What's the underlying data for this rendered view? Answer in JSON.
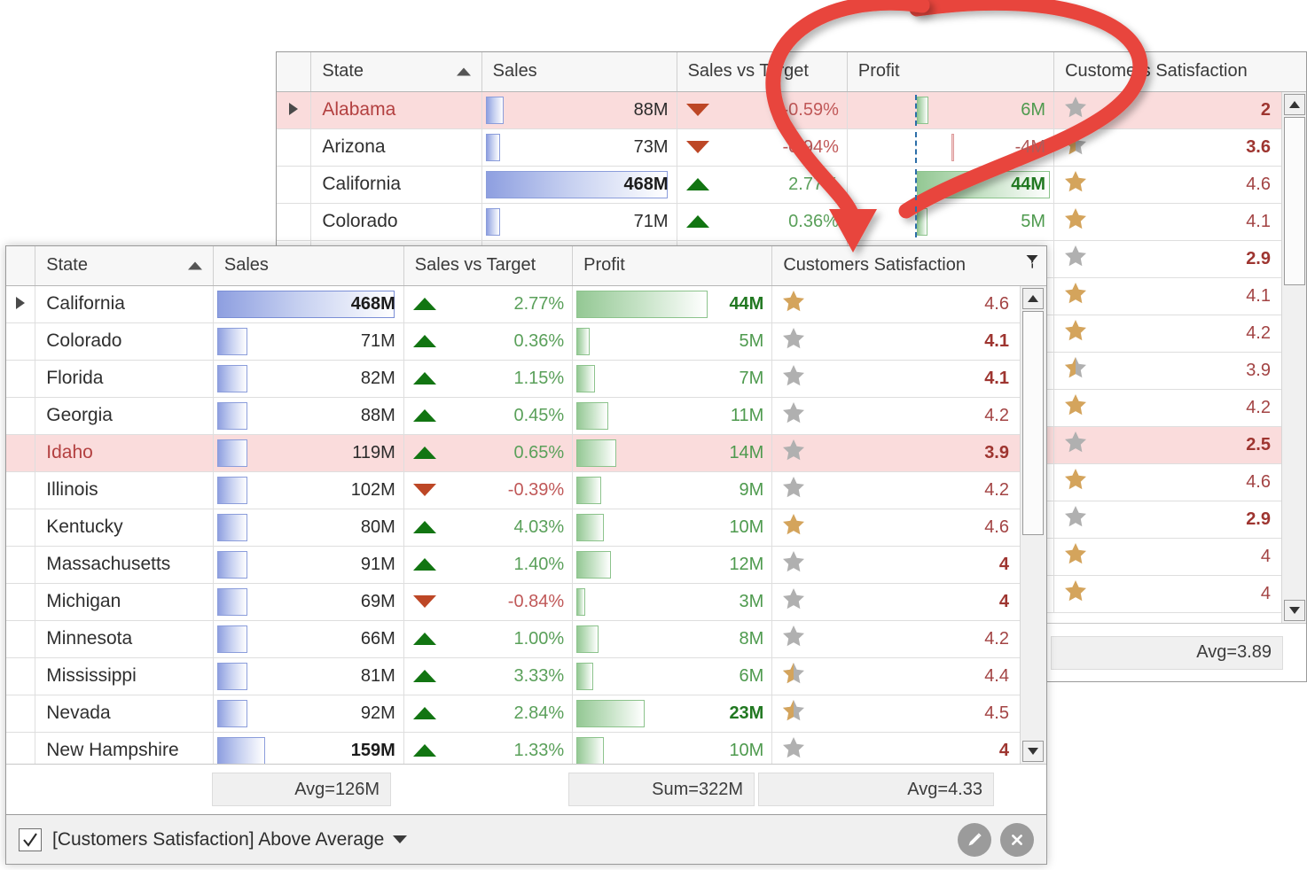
{
  "background_grid": {
    "name": "unfiltered-grid",
    "columns": [
      {
        "key": "state",
        "label": "State",
        "sorted": "asc"
      },
      {
        "key": "sales",
        "label": "Sales"
      },
      {
        "key": "svt",
        "label": "Sales vs Target"
      },
      {
        "key": "profit",
        "label": "Profit"
      },
      {
        "key": "sat",
        "label": "Customers Satisfaction"
      }
    ],
    "rows": [
      {
        "state": "Alabama",
        "sales": "88M",
        "sales_bar": 0.1,
        "svt": "-0.59%",
        "svt_dir": "down",
        "profit": "6M",
        "profit_bar": 0.09,
        "profit_neg": false,
        "sat": "2",
        "sat_bold": true,
        "star": "grey",
        "alert": true,
        "indicator": true,
        "sales_bold": false,
        "profit_bold": false
      },
      {
        "state": "Arizona",
        "sales": "73M",
        "sales_bar": 0.08,
        "svt": "-0.94%",
        "svt_dir": "down",
        "profit": "-4M",
        "profit_bar": 0.06,
        "profit_neg": true,
        "sat": "3.6",
        "sat_bold": true,
        "star": "gold-half",
        "alert": false,
        "indicator": false,
        "sales_bold": false,
        "profit_bold": false
      },
      {
        "state": "California",
        "sales": "468M",
        "sales_bar": 1.0,
        "svt": "2.77%",
        "svt_dir": "up",
        "profit": "44M",
        "profit_bar": 1.0,
        "profit_neg": false,
        "sat": "4.6",
        "sat_bold": false,
        "star": "gold",
        "alert": false,
        "indicator": false,
        "sales_bold": true,
        "profit_bold": true
      },
      {
        "state": "Colorado",
        "sales": "71M",
        "sales_bar": 0.08,
        "svt": "0.36%",
        "svt_dir": "up",
        "profit": "5M",
        "profit_bar": 0.08,
        "profit_neg": false,
        "sat": "4.1",
        "sat_bold": false,
        "star": "gold",
        "alert": false,
        "indicator": false,
        "sales_bold": false,
        "profit_bold": false
      }
    ],
    "satisfaction_tail": [
      {
        "sat": "2.9",
        "bold": true,
        "star": "grey",
        "alert": false
      },
      {
        "sat": "4.1",
        "bold": false,
        "star": "gold",
        "alert": false
      },
      {
        "sat": "4.2",
        "bold": false,
        "star": "gold",
        "alert": false
      },
      {
        "sat": "3.9",
        "bold": false,
        "star": "gold-half",
        "alert": false
      },
      {
        "sat": "4.2",
        "bold": false,
        "star": "gold",
        "alert": false
      },
      {
        "sat": "2.5",
        "bold": true,
        "star": "grey",
        "alert": true
      },
      {
        "sat": "4.6",
        "bold": false,
        "star": "gold",
        "alert": false
      },
      {
        "sat": "2.9",
        "bold": true,
        "star": "grey",
        "alert": false
      },
      {
        "sat": "4",
        "bold": false,
        "star": "gold",
        "alert": false
      },
      {
        "sat": "4",
        "bold": false,
        "star": "gold",
        "alert": false
      }
    ],
    "summary": {
      "satisfaction": "Avg=3.89"
    }
  },
  "foreground_grid": {
    "name": "filtered-grid",
    "columns": [
      {
        "key": "state",
        "label": "State",
        "sorted": "asc"
      },
      {
        "key": "sales",
        "label": "Sales"
      },
      {
        "key": "svt",
        "label": "Sales vs Target"
      },
      {
        "key": "profit",
        "label": "Profit"
      },
      {
        "key": "sat",
        "label": "Customers Satisfaction",
        "filtered": true
      }
    ],
    "rows": [
      {
        "state": "California",
        "sales": "468M",
        "sales_bar": 1.0,
        "sales_bold": true,
        "svt": "2.77%",
        "svt_dir": "up",
        "profit": "44M",
        "profit_bar": 1.0,
        "profit_bold": true,
        "sat": "4.6",
        "sat_bold": false,
        "star": "gold",
        "alert": false,
        "indicator": true
      },
      {
        "state": "Colorado",
        "sales": "71M",
        "sales_bar": 0.085,
        "sales_bold": false,
        "svt": "0.36%",
        "svt_dir": "up",
        "profit": "5M",
        "profit_bar": 0.1,
        "profit_bold": false,
        "sat": "4.1",
        "sat_bold": true,
        "star": "grey",
        "alert": false,
        "indicator": false
      },
      {
        "state": "Florida",
        "sales": "82M",
        "sales_bar": 0.1,
        "sales_bold": false,
        "svt": "1.15%",
        "svt_dir": "up",
        "profit": "7M",
        "profit_bar": 0.14,
        "profit_bold": false,
        "sat": "4.1",
        "sat_bold": true,
        "star": "grey",
        "alert": false,
        "indicator": false
      },
      {
        "state": "Georgia",
        "sales": "88M",
        "sales_bar": 0.11,
        "sales_bold": false,
        "svt": "0.45%",
        "svt_dir": "up",
        "profit": "11M",
        "profit_bar": 0.24,
        "profit_bold": false,
        "sat": "4.2",
        "sat_bold": false,
        "star": "grey",
        "alert": false,
        "indicator": false
      },
      {
        "state": "Idaho",
        "sales": "119M",
        "sales_bar": 0.165,
        "sales_bold": false,
        "svt": "0.65%",
        "svt_dir": "up",
        "profit": "14M",
        "profit_bar": 0.3,
        "profit_bold": false,
        "sat": "3.9",
        "sat_bold": true,
        "star": "grey",
        "alert": true,
        "indicator": false
      },
      {
        "state": "Illinois",
        "sales": "102M",
        "sales_bar": 0.135,
        "sales_bold": false,
        "svt": "-0.39%",
        "svt_dir": "down",
        "profit": "9M",
        "profit_bar": 0.19,
        "profit_bold": false,
        "sat": "4.2",
        "sat_bold": false,
        "star": "grey",
        "alert": false,
        "indicator": false
      },
      {
        "state": "Kentucky",
        "sales": "80M",
        "sales_bar": 0.1,
        "sales_bold": false,
        "svt": "4.03%",
        "svt_dir": "up",
        "profit": "10M",
        "profit_bar": 0.21,
        "profit_bold": false,
        "sat": "4.6",
        "sat_bold": false,
        "star": "gold",
        "alert": false,
        "indicator": false
      },
      {
        "state": "Massachusetts",
        "sales": "91M",
        "sales_bar": 0.115,
        "sales_bold": false,
        "svt": "1.40%",
        "svt_dir": "up",
        "profit": "12M",
        "profit_bar": 0.26,
        "profit_bold": false,
        "sat": "4",
        "sat_bold": true,
        "star": "grey",
        "alert": false,
        "indicator": false
      },
      {
        "state": "Michigan",
        "sales": "69M",
        "sales_bar": 0.08,
        "sales_bold": false,
        "svt": "-0.84%",
        "svt_dir": "down",
        "profit": "3M",
        "profit_bar": 0.05,
        "profit_bold": false,
        "sat": "4",
        "sat_bold": true,
        "star": "grey",
        "alert": false,
        "indicator": false
      },
      {
        "state": "Minnesota",
        "sales": "66M",
        "sales_bar": 0.075,
        "sales_bold": false,
        "svt": "1.00%",
        "svt_dir": "up",
        "profit": "8M",
        "profit_bar": 0.17,
        "profit_bold": false,
        "sat": "4.2",
        "sat_bold": false,
        "star": "grey",
        "alert": false,
        "indicator": false
      },
      {
        "state": "Mississippi",
        "sales": "81M",
        "sales_bar": 0.1,
        "sales_bold": false,
        "svt": "3.33%",
        "svt_dir": "up",
        "profit": "6M",
        "profit_bar": 0.13,
        "profit_bold": false,
        "sat": "4.4",
        "sat_bold": false,
        "star": "gold-half",
        "alert": false,
        "indicator": false
      },
      {
        "state": "Nevada",
        "sales": "92M",
        "sales_bar": 0.115,
        "sales_bold": false,
        "svt": "2.84%",
        "svt_dir": "up",
        "profit": "23M",
        "profit_bar": 0.52,
        "profit_bold": true,
        "sat": "4.5",
        "sat_bold": false,
        "star": "gold-half",
        "alert": false,
        "indicator": false
      },
      {
        "state": "New Hampshire",
        "sales": "159M",
        "sales_bar": 0.27,
        "sales_bold": true,
        "svt": "1.33%",
        "svt_dir": "up",
        "profit": "10M",
        "profit_bar": 0.21,
        "profit_bold": false,
        "sat": "4",
        "sat_bold": true,
        "star": "grey",
        "alert": false,
        "indicator": false
      }
    ],
    "summary": {
      "sales": "Avg=126M",
      "profit": "Sum=322M",
      "satisfaction": "Avg=4.33"
    },
    "filter_panel": {
      "checked": true,
      "expression": "[Customers Satisfaction] Above Average",
      "edit_icon": "pencil-icon",
      "close_icon": "close-circle-icon"
    }
  },
  "annotation": {
    "arrow_color": "#e8453c",
    "icon": "curved-arrow-annotation",
    "description": "curved arrow pointing from Customers Satisfaction header of the background grid to the Customers Satisfaction header of the filtered grid"
  },
  "colors": {
    "alert_row": "#fadcdc",
    "header_bg": "#f7f7f7",
    "positive": "#5aa05a",
    "negative": "#c05858",
    "star_gold": "#d4a45c",
    "star_grey": "#b0b0b0",
    "sales_bar": "#8e9fe0",
    "profit_bar": "#94c894",
    "arrow_red": "#e8453c"
  }
}
